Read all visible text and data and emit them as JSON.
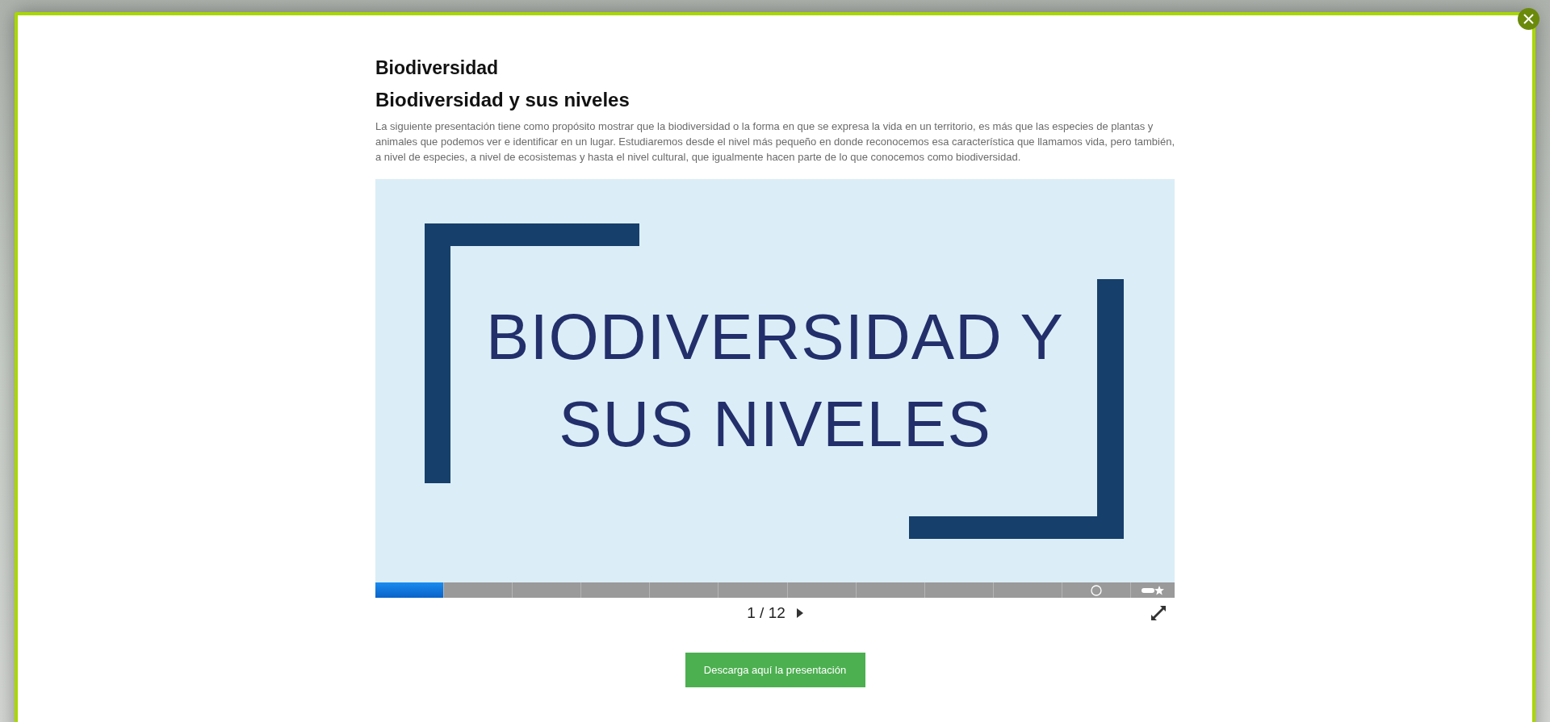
{
  "modal": {
    "title": "Biodiversidad",
    "subtitle": "Biodiversidad y sus niveles",
    "description": "La siguiente presentación tiene como propósito mostrar que la biodiversidad o la forma en que se expresa la vida en un territorio, es más que las especies de plantas y animales que podemos ver e identificar en un lugar. Estudiaremos desde el nivel más pequeño en donde reconocemos esa característica que llamamos vida, pero también, a nivel de especies, a nivel de ecosistemas y hasta el nivel cultural, que igualmente hacen parte de lo que conocemos como biodiversidad."
  },
  "slide": {
    "title_lines": [
      "BIODIVERSIDAD Y",
      "SUS NIVELES"
    ]
  },
  "progress": {
    "level": 0.0859
  },
  "pager": {
    "current": "1",
    "separator": "/",
    "total": "12"
  },
  "download_button": "Descarga aquí la presentación"
}
